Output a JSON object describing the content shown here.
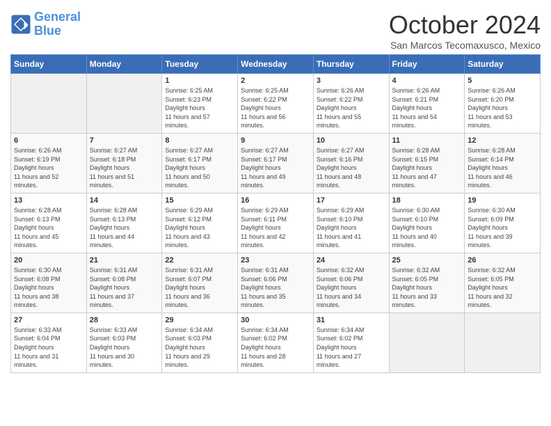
{
  "logo": {
    "line1": "General",
    "line2": "Blue"
  },
  "title": "October 2024",
  "location": "San Marcos Tecomaxusco, Mexico",
  "days_header": [
    "Sunday",
    "Monday",
    "Tuesday",
    "Wednesday",
    "Thursday",
    "Friday",
    "Saturday"
  ],
  "weeks": [
    [
      {
        "day": "",
        "empty": true
      },
      {
        "day": "",
        "empty": true
      },
      {
        "day": "1",
        "sunrise": "6:25 AM",
        "sunset": "6:23 PM",
        "daylight": "11 hours and 57 minutes."
      },
      {
        "day": "2",
        "sunrise": "6:25 AM",
        "sunset": "6:22 PM",
        "daylight": "11 hours and 56 minutes."
      },
      {
        "day": "3",
        "sunrise": "6:26 AM",
        "sunset": "6:22 PM",
        "daylight": "11 hours and 55 minutes."
      },
      {
        "day": "4",
        "sunrise": "6:26 AM",
        "sunset": "6:21 PM",
        "daylight": "11 hours and 54 minutes."
      },
      {
        "day": "5",
        "sunrise": "6:26 AM",
        "sunset": "6:20 PM",
        "daylight": "11 hours and 53 minutes."
      }
    ],
    [
      {
        "day": "6",
        "sunrise": "6:26 AM",
        "sunset": "6:19 PM",
        "daylight": "11 hours and 52 minutes."
      },
      {
        "day": "7",
        "sunrise": "6:27 AM",
        "sunset": "6:18 PM",
        "daylight": "11 hours and 51 minutes."
      },
      {
        "day": "8",
        "sunrise": "6:27 AM",
        "sunset": "6:17 PM",
        "daylight": "11 hours and 50 minutes."
      },
      {
        "day": "9",
        "sunrise": "6:27 AM",
        "sunset": "6:17 PM",
        "daylight": "11 hours and 49 minutes."
      },
      {
        "day": "10",
        "sunrise": "6:27 AM",
        "sunset": "6:16 PM",
        "daylight": "11 hours and 48 minutes."
      },
      {
        "day": "11",
        "sunrise": "6:28 AM",
        "sunset": "6:15 PM",
        "daylight": "11 hours and 47 minutes."
      },
      {
        "day": "12",
        "sunrise": "6:28 AM",
        "sunset": "6:14 PM",
        "daylight": "11 hours and 46 minutes."
      }
    ],
    [
      {
        "day": "13",
        "sunrise": "6:28 AM",
        "sunset": "6:13 PM",
        "daylight": "11 hours and 45 minutes."
      },
      {
        "day": "14",
        "sunrise": "6:28 AM",
        "sunset": "6:13 PM",
        "daylight": "11 hours and 44 minutes."
      },
      {
        "day": "15",
        "sunrise": "6:29 AM",
        "sunset": "6:12 PM",
        "daylight": "11 hours and 43 minutes."
      },
      {
        "day": "16",
        "sunrise": "6:29 AM",
        "sunset": "6:11 PM",
        "daylight": "11 hours and 42 minutes."
      },
      {
        "day": "17",
        "sunrise": "6:29 AM",
        "sunset": "6:10 PM",
        "daylight": "11 hours and 41 minutes."
      },
      {
        "day": "18",
        "sunrise": "6:30 AM",
        "sunset": "6:10 PM",
        "daylight": "11 hours and 40 minutes."
      },
      {
        "day": "19",
        "sunrise": "6:30 AM",
        "sunset": "6:09 PM",
        "daylight": "11 hours and 39 minutes."
      }
    ],
    [
      {
        "day": "20",
        "sunrise": "6:30 AM",
        "sunset": "6:08 PM",
        "daylight": "11 hours and 38 minutes."
      },
      {
        "day": "21",
        "sunrise": "6:31 AM",
        "sunset": "6:08 PM",
        "daylight": "11 hours and 37 minutes."
      },
      {
        "day": "22",
        "sunrise": "6:31 AM",
        "sunset": "6:07 PM",
        "daylight": "11 hours and 36 minutes."
      },
      {
        "day": "23",
        "sunrise": "6:31 AM",
        "sunset": "6:06 PM",
        "daylight": "11 hours and 35 minutes."
      },
      {
        "day": "24",
        "sunrise": "6:32 AM",
        "sunset": "6:06 PM",
        "daylight": "11 hours and 34 minutes."
      },
      {
        "day": "25",
        "sunrise": "6:32 AM",
        "sunset": "6:05 PM",
        "daylight": "11 hours and 33 minutes."
      },
      {
        "day": "26",
        "sunrise": "6:32 AM",
        "sunset": "6:05 PM",
        "daylight": "11 hours and 32 minutes."
      }
    ],
    [
      {
        "day": "27",
        "sunrise": "6:33 AM",
        "sunset": "6:04 PM",
        "daylight": "11 hours and 31 minutes."
      },
      {
        "day": "28",
        "sunrise": "6:33 AM",
        "sunset": "6:03 PM",
        "daylight": "11 hours and 30 minutes."
      },
      {
        "day": "29",
        "sunrise": "6:34 AM",
        "sunset": "6:03 PM",
        "daylight": "11 hours and 29 minutes."
      },
      {
        "day": "30",
        "sunrise": "6:34 AM",
        "sunset": "6:02 PM",
        "daylight": "11 hours and 28 minutes."
      },
      {
        "day": "31",
        "sunrise": "6:34 AM",
        "sunset": "6:02 PM",
        "daylight": "11 hours and 27 minutes."
      },
      {
        "day": "",
        "empty": true
      },
      {
        "day": "",
        "empty": true
      }
    ]
  ],
  "labels": {
    "sunrise": "Sunrise:",
    "sunset": "Sunset:",
    "daylight": "Daylight:"
  }
}
